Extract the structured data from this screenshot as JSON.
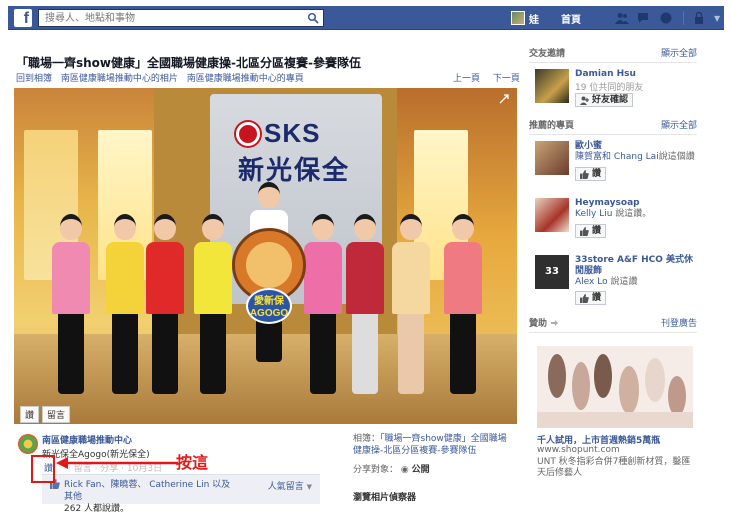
{
  "topbar": {
    "search_placeholder": "搜尋人、地點和事物",
    "user_name": "娃",
    "home_label": "首頁"
  },
  "photo": {
    "title": "「職場一齊show健康」全國職場健康操-北區分區複賽-參賽隊伍",
    "breadcrumb": [
      "回到相簿",
      "南區健康職場推動中心的相片",
      "南區健康職場推動中心的專頁"
    ],
    "prev_label": "上一頁",
    "next_label": "下一頁",
    "scene": {
      "logo_text": "SKS",
      "logo_cn": "新光保全",
      "mascot_line1": "愛新保",
      "mascot_line2": "AGOGO"
    },
    "overlay_like": "讚",
    "overlay_comment": "留言"
  },
  "post": {
    "owner_name": "南區健康職場推動中心",
    "caption": "新光保全Agogo(新光保全)",
    "like_label": "讚",
    "comment_share": "· 留言 · 分享 · 10月3日",
    "annotation": "按這",
    "likes_names": "Rick Fan、陳曉蓉、 Catherine Lin 以及其他",
    "likes_count_text": "262 人都說讚。",
    "top_comments": "人氣留言"
  },
  "album": {
    "label": "相簿：",
    "name": "「職場一齊show健康」全國職場健康操-北區分區複賽-參賽隊伍",
    "share_label": "分享對象：",
    "share_value": "公開",
    "related_label": "瀏覽相片偵察器"
  },
  "sidebar": {
    "friend_requests": {
      "heading": "交友邀請",
      "see_all": "顯示全部",
      "items": [
        {
          "name": "Damian Hsu",
          "mutual": "19 位共同的朋友",
          "button": "好友確認"
        }
      ]
    },
    "recommended_pages": {
      "heading": "推薦的專頁",
      "see_all": "顯示全部",
      "items": [
        {
          "name": "歐小蜜",
          "sub_link": "陳賀富和 Chang Lai",
          "sub_text": "說這個讚",
          "button": "讚"
        },
        {
          "name": "Heymaysoap",
          "sub_link": "Kelly Liu",
          "sub_text": "說這讚。",
          "button": "讚"
        },
        {
          "name": "33store A&F HCO 美式休閒服飾",
          "sub_link": "Alex Lo",
          "sub_text": "說這讚",
          "button": "讚"
        }
      ]
    },
    "sponsored": {
      "heading": "贊助",
      "create_ad": "刊登廣告",
      "ad_title": "千人試用，上市首週熱銷5萬瓶",
      "ad_url": "www.shopunt.com",
      "ad_desc": "UNT 秋冬指彩合併7種創新材質，鑿匯天后修藝人"
    }
  },
  "colors": {
    "fb_blue": "#3b5998",
    "annotation_red": "#e01818"
  }
}
